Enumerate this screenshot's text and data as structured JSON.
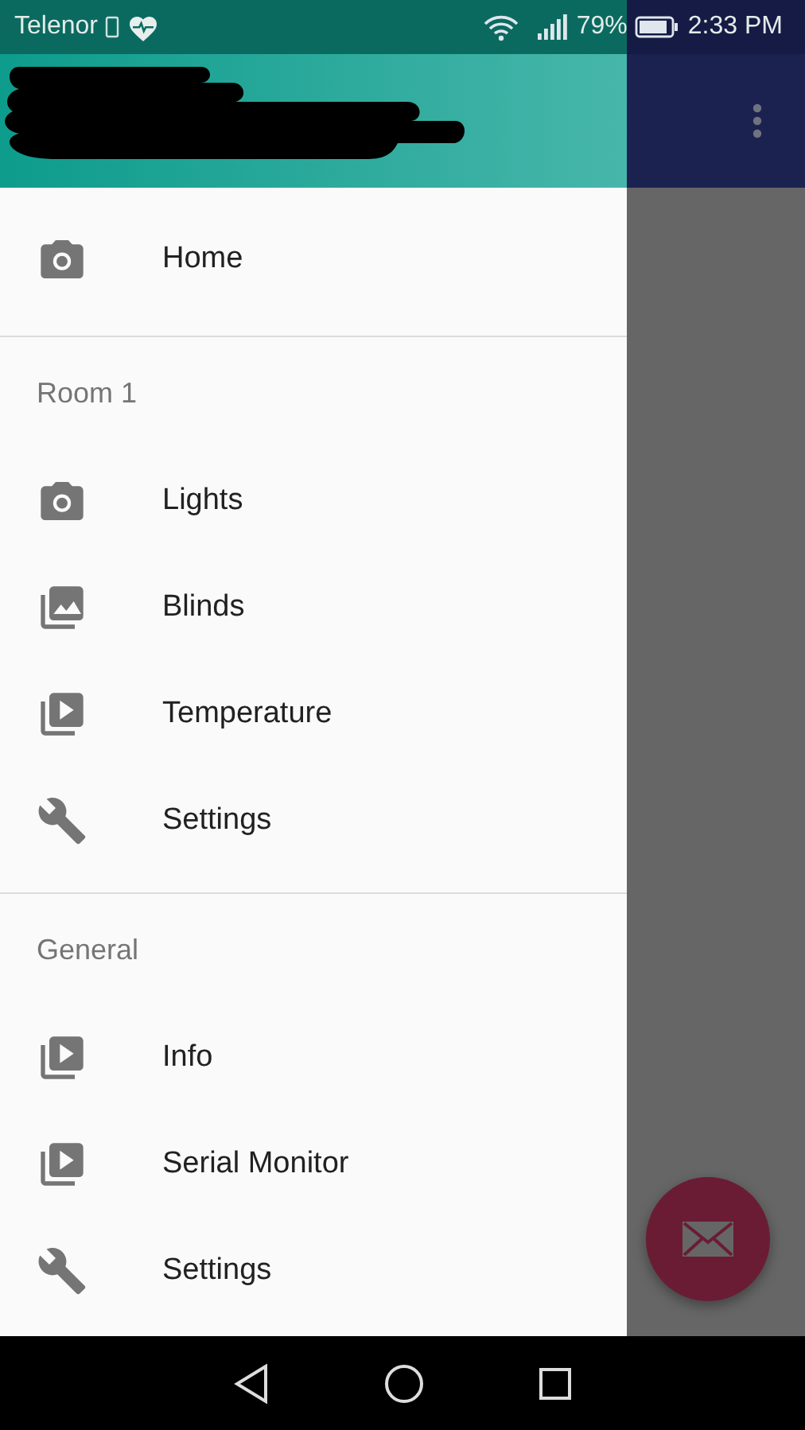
{
  "status_bar": {
    "carrier": "Telenor",
    "battery": "79%",
    "time": "2:33 PM"
  },
  "drawer": {
    "sections": [
      {
        "items": [
          {
            "label": "Home",
            "kind": "camera"
          }
        ]
      },
      {
        "header": "Room 1",
        "items": [
          {
            "label": "Lights",
            "kind": "camera"
          },
          {
            "label": "Blinds",
            "kind": "photos"
          },
          {
            "label": "Temperature",
            "kind": "video"
          },
          {
            "label": "Settings",
            "kind": "wrench"
          }
        ]
      },
      {
        "header": "General",
        "items": [
          {
            "label": "Info",
            "kind": "video"
          },
          {
            "label": "Serial Monitor",
            "kind": "video"
          },
          {
            "label": "Settings",
            "kind": "wrench"
          }
        ]
      }
    ]
  }
}
